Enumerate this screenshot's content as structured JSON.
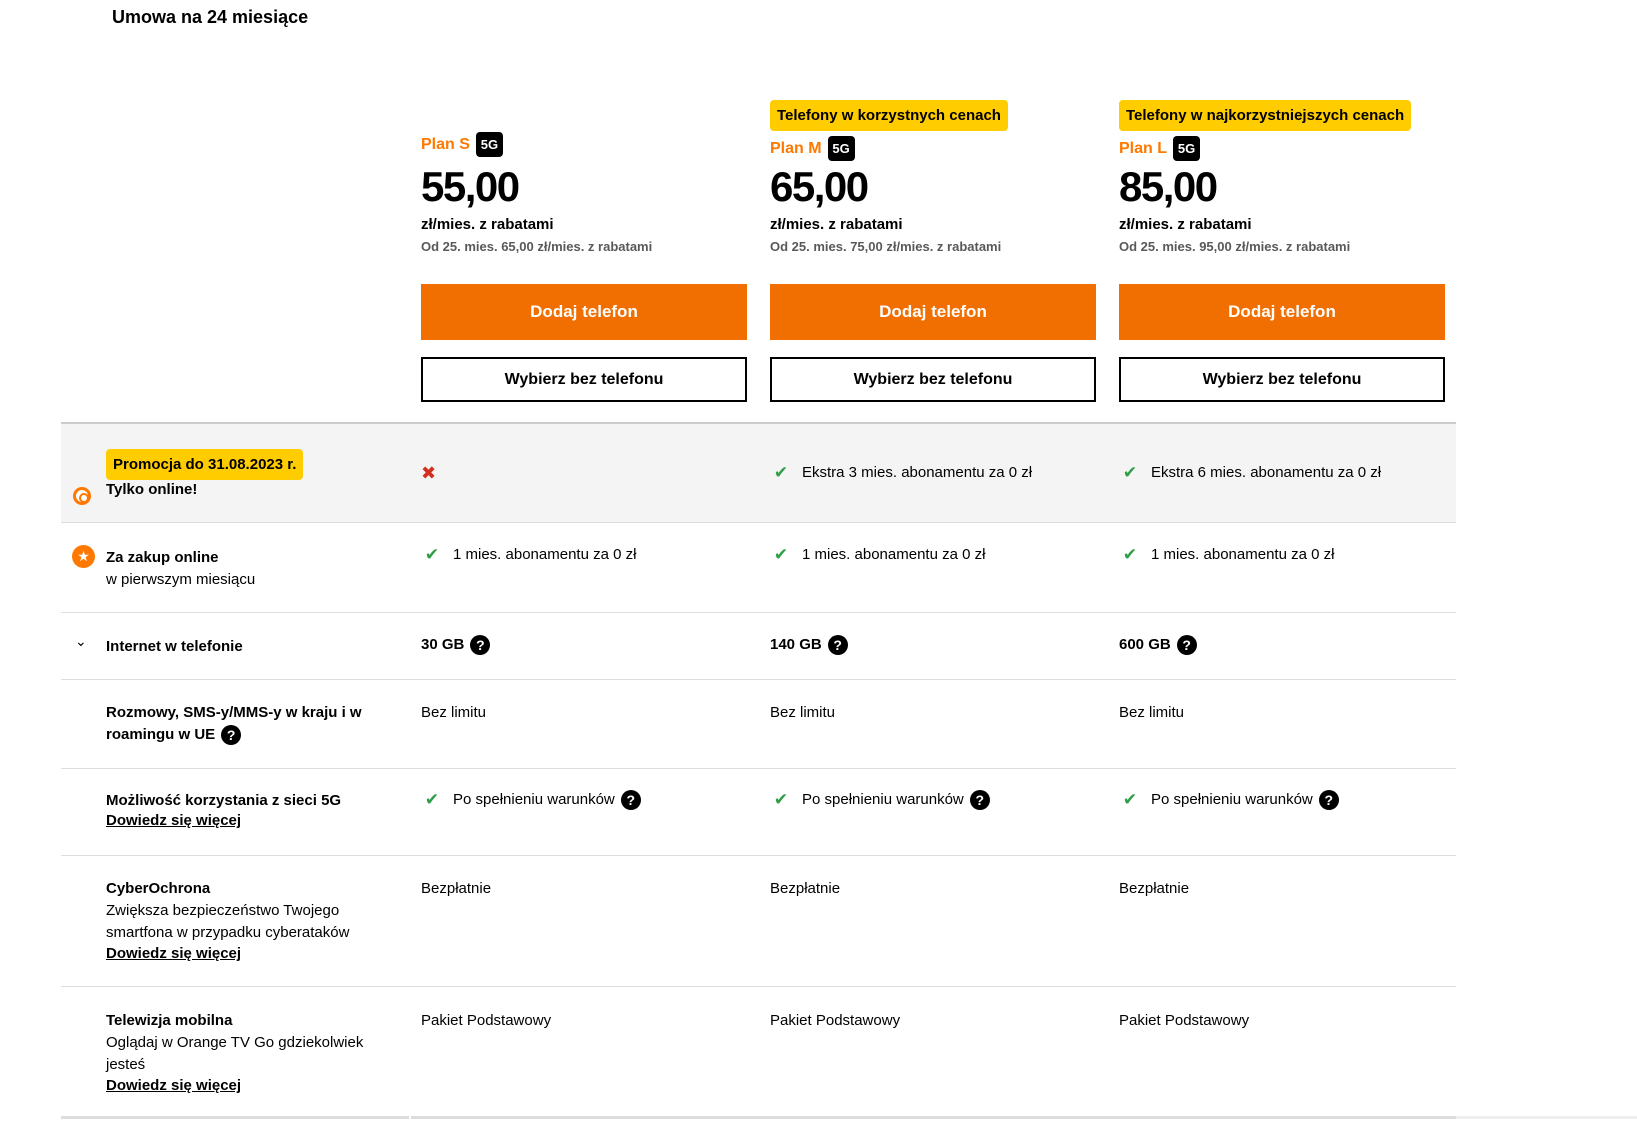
{
  "contract_title": "Umowa na 24 miesiące",
  "plans": [
    {
      "badge": "",
      "name": "Plan S",
      "tag": "5G",
      "price": "55,00",
      "price_unit": "zł/mies. z rabatami",
      "price_later": "Od 25. mies. 65,00 zł/mies. z rabatami",
      "primary_button": "Dodaj telefon",
      "secondary_button": "Wybierz bez telefonu"
    },
    {
      "badge": "Telefony w korzystnych cenach",
      "name": "Plan M",
      "tag": "5G",
      "price": "65,00",
      "price_unit": "zł/mies. z rabatami",
      "price_later": "Od 25. mies. 75,00 zł/mies. z rabatami",
      "primary_button": "Dodaj telefon",
      "secondary_button": "Wybierz bez telefonu"
    },
    {
      "badge": "Telefony w najkorzystniejszych cenach",
      "name": "Plan L",
      "tag": "5G",
      "price": "85,00",
      "price_unit": "zł/mies. z rabatami",
      "price_later": "Od 25. mies. 95,00 zł/mies. z rabatami",
      "primary_button": "Dodaj telefon",
      "secondary_button": "Wybierz bez telefonu"
    }
  ],
  "rows": {
    "promo": {
      "badge": "Promocja do 31.08.2023 r.",
      "label": "Tylko online!",
      "values": [
        "",
        "Ekstra 3 mies. abonamentu za 0 zł",
        "Ekstra 6 mies. abonamentu za 0 zł"
      ],
      "included": [
        false,
        true,
        true
      ]
    },
    "online": {
      "label": "Za zakup online",
      "sublabel": "w pierwszym miesiącu",
      "values": [
        "1 mies. abonamentu za 0 zł",
        "1 mies. abonamentu za 0 zł",
        "1 mies. abonamentu za 0 zł"
      ]
    },
    "internet": {
      "label": "Internet w telefonie",
      "values": [
        "30 GB",
        "140 GB",
        "600 GB"
      ]
    },
    "calls": {
      "label_line1": "Rozmowy, SMS-y/MMS-y w kraju i w",
      "label_line2": "roamingu w UE",
      "values": [
        "Bez limitu",
        "Bez limitu",
        "Bez limitu"
      ]
    },
    "network5g": {
      "label": "Możliwość korzystania z sieci 5G",
      "link": "Dowiedz się więcej",
      "values": [
        "Po spełnieniu warunków",
        "Po spełnieniu warunków",
        "Po spełnieniu warunków"
      ]
    },
    "cyber": {
      "label": "CyberOchrona",
      "desc_line1": "Zwiększa bezpieczeństwo Twojego",
      "desc_line2": "smartfona w przypadku cyberataków",
      "link": "Dowiedz się więcej",
      "values": [
        "Bezpłatnie",
        "Bezpłatnie",
        "Bezpłatnie"
      ]
    },
    "tv": {
      "label": "Telewizja mobilna",
      "desc_line1": "Oglądaj w Orange TV Go gdziekolwiek",
      "desc_line2": "jesteś",
      "link": "Dowiedz się więcej",
      "values": [
        "Pakiet Podstawowy",
        "Pakiet Podstawowy",
        "Pakiet Podstawowy"
      ]
    }
  },
  "icons": {
    "check": "✔",
    "cross": "✖",
    "question": "?",
    "chevron": "⌄"
  },
  "colors": {
    "accent_orange": "#f16e00",
    "brand_orange": "#ff7900",
    "badge_yellow": "#ffcc00",
    "check_green": "#2e9e47",
    "cross_red": "#d22f1c"
  }
}
